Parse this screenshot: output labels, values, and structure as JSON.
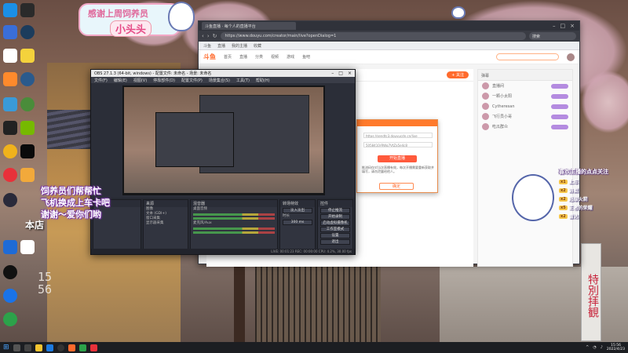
{
  "overlay": {
    "thanks_line": "感谢上周饲养员",
    "thanks_name": "小头头",
    "help_lines": [
      "饲养员们帮帮忙",
      "飞机换成上车卡吧",
      "谢谢～爱你们哟"
    ],
    "shop_label": "本店",
    "clock_lines": [
      "15",
      "56"
    ],
    "right_title": "喜欢主播的点点关注",
    "right_rows": [
      {
        "badge": "x1",
        "name": "上车"
      },
      {
        "badge": "x2",
        "name": "游艇"
      },
      {
        "badge": "x2",
        "name": "超级火箭"
      },
      {
        "badge": "x5",
        "name": "王者的荣耀"
      },
      {
        "badge": "x2",
        "name": "雷达"
      }
    ],
    "sign_text": "特別拝観"
  },
  "browser": {
    "tab_title": "斗鱼直播 · 每个人的直播平台",
    "url": "https://www.douyu.com/creator/main/live?openDialog=1",
    "search_placeholder": "搜索",
    "bookmarks": [
      "斗鱼",
      "直播",
      "我的主播",
      "收藏"
    ],
    "site_logo": "斗鱼",
    "site_nav": [
      "首页",
      "直播",
      "分类",
      "视频",
      "游戏",
      "鱼吧"
    ],
    "room_follow_label": "+ 关注",
    "chat_header": "弹幕",
    "chat_users": [
      "直播间",
      "一颗小太阳",
      "Cytheresan",
      "飞行员小哥",
      "吃瓜群众"
    ]
  },
  "dialog": {
    "server_field": "https://sendtc3.douyucdn.cn/live",
    "key_field": "5058410rRWq7VtZa5e4c8",
    "start_button": "开始直播",
    "note": "推流码仅对当次直播有效，每次开播需要重新获取并填写，请勿泄露给他人。",
    "ok_button": "确定"
  },
  "obs": {
    "title": "OBS 27.1.3 (64-bit, windows) - 配置文件: 未命名 - 场景: 未命名",
    "menu": [
      "文件(F)",
      "编辑(E)",
      "视图(V)",
      "停靠部件(D)",
      "配置文件(P)",
      "场景集合(S)",
      "工具(T)",
      "帮助(H)"
    ],
    "docks": {
      "scenes_title": "场景",
      "sources_title": "来源",
      "sources": [
        "图像",
        "文本 (GDI+)",
        "窗口采集",
        "显示器采集"
      ],
      "mixer_title": "混音器",
      "mixer_channels": [
        "桌面音频",
        "麦克风/Aux"
      ],
      "transitions_title": "转场特效",
      "transition_value": "淡入淡出",
      "duration_label": "时长",
      "duration_value": "300 ms",
      "controls_title": "控件",
      "controls": [
        "停止推流",
        "开始录制",
        "启动虚拟摄像机",
        "工作室模式",
        "设置",
        "退出"
      ]
    },
    "status": "LIVE: 00:01:23   REC: 00:00:00   CPU: 4.2%, 30.00 fps"
  },
  "taskbar": {
    "time": "15:56",
    "date": "2022/4/23"
  }
}
